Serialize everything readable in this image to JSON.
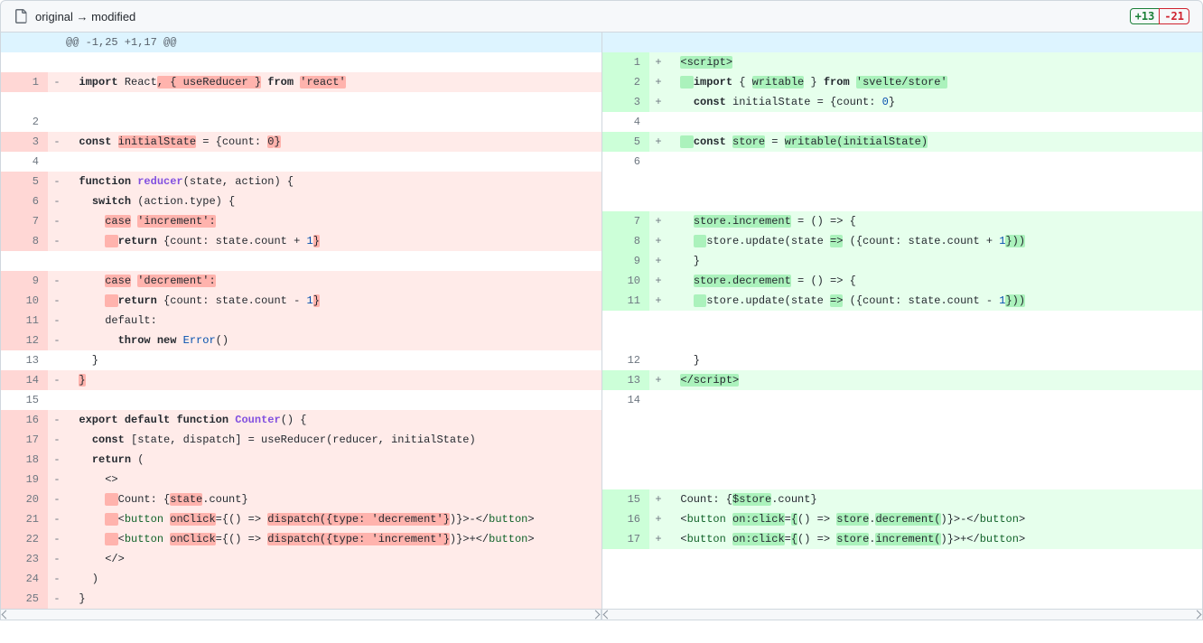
{
  "header": {
    "title": "original → modified",
    "additions": "+13",
    "deletions": "-21"
  },
  "hunk": "@@ -1,25 +1,17 @@",
  "left": [
    {
      "n": "",
      "t": "empty"
    },
    {
      "n": "1",
      "t": "del",
      "seg": [
        [
          "",
          "  "
        ],
        [
          "kw",
          "import"
        ],
        [
          "",
          " React"
        ],
        [
          "h-d",
          ", { useReducer }"
        ],
        [
          "",
          " "
        ],
        [
          "kw",
          "from"
        ],
        [
          "",
          " "
        ],
        [
          "h-d",
          "'react'"
        ]
      ]
    },
    {
      "n": "",
      "t": "empty"
    },
    {
      "n": "2",
      "t": "ctx",
      "seg": [
        [
          "",
          "  "
        ]
      ]
    },
    {
      "n": "3",
      "t": "del",
      "seg": [
        [
          "",
          "  "
        ],
        [
          "kw",
          "const"
        ],
        [
          "",
          " "
        ],
        [
          "h-d",
          "initialState"
        ],
        [
          "",
          " = {count: "
        ],
        [
          "h-d",
          "0"
        ],
        [
          "h-d",
          "}"
        ]
      ]
    },
    {
      "n": "4",
      "t": "ctx",
      "seg": [
        [
          "",
          "  "
        ]
      ]
    },
    {
      "n": "5",
      "t": "del",
      "seg": [
        [
          "",
          "  "
        ],
        [
          "kw",
          "function"
        ],
        [
          "",
          " "
        ],
        [
          "fn",
          "reducer"
        ],
        [
          "",
          "(state, action) {"
        ]
      ]
    },
    {
      "n": "6",
      "t": "del",
      "seg": [
        [
          "",
          "    "
        ],
        [
          "kw",
          "switch"
        ],
        [
          "",
          " (action.type) {"
        ]
      ]
    },
    {
      "n": "7",
      "t": "del",
      "seg": [
        [
          "",
          "      "
        ],
        [
          "h-d",
          "case"
        ],
        [
          "",
          " "
        ],
        [
          "h-d",
          "'increment':"
        ]
      ]
    },
    {
      "n": "8",
      "t": "del",
      "seg": [
        [
          "",
          "      "
        ],
        [
          "h-d",
          "  "
        ],
        [
          "kw",
          "return"
        ],
        [
          "",
          " {count: state.count + "
        ],
        [
          "nm",
          "1"
        ],
        [
          "h-d",
          "}"
        ]
      ]
    },
    {
      "n": "",
      "t": "empty"
    },
    {
      "n": "9",
      "t": "del",
      "seg": [
        [
          "",
          "      "
        ],
        [
          "h-d",
          "case"
        ],
        [
          "",
          " "
        ],
        [
          "h-d",
          "'decrement':"
        ]
      ]
    },
    {
      "n": "10",
      "t": "del",
      "seg": [
        [
          "",
          "      "
        ],
        [
          "h-d",
          "  "
        ],
        [
          "kw",
          "return"
        ],
        [
          "",
          " {count: state.count - "
        ],
        [
          "nm",
          "1"
        ],
        [
          "h-d",
          "}"
        ]
      ]
    },
    {
      "n": "11",
      "t": "del",
      "seg": [
        [
          "",
          "      default:"
        ]
      ]
    },
    {
      "n": "12",
      "t": "del",
      "seg": [
        [
          "",
          "        "
        ],
        [
          "kw",
          "throw"
        ],
        [
          "",
          " "
        ],
        [
          "kw",
          "new"
        ],
        [
          "",
          " "
        ],
        [
          "nm",
          "Error"
        ],
        [
          "",
          "()"
        ]
      ]
    },
    {
      "n": "13",
      "t": "ctx",
      "seg": [
        [
          "",
          "    }"
        ]
      ]
    },
    {
      "n": "14",
      "t": "del",
      "seg": [
        [
          "",
          "  "
        ],
        [
          "h-d",
          "}"
        ]
      ]
    },
    {
      "n": "15",
      "t": "ctx",
      "seg": [
        [
          "",
          "  "
        ]
      ]
    },
    {
      "n": "16",
      "t": "del",
      "seg": [
        [
          "",
          "  "
        ],
        [
          "kw",
          "export"
        ],
        [
          "",
          " "
        ],
        [
          "kw",
          "default"
        ],
        [
          "",
          " "
        ],
        [
          "kw",
          "function"
        ],
        [
          "",
          " "
        ],
        [
          "fn",
          "Counter"
        ],
        [
          "",
          "() {"
        ]
      ]
    },
    {
      "n": "17",
      "t": "del",
      "seg": [
        [
          "",
          "    "
        ],
        [
          "kw",
          "const"
        ],
        [
          "",
          " [state, dispatch] = useReducer(reducer, initialState)"
        ]
      ]
    },
    {
      "n": "18",
      "t": "del",
      "seg": [
        [
          "",
          "    "
        ],
        [
          "kw",
          "return"
        ],
        [
          "",
          " ("
        ]
      ]
    },
    {
      "n": "19",
      "t": "del",
      "seg": [
        [
          "",
          "      <>"
        ]
      ]
    },
    {
      "n": "20",
      "t": "del",
      "seg": [
        [
          "",
          "      "
        ],
        [
          "h-d",
          "  "
        ],
        [
          "",
          "Count: {"
        ],
        [
          "h-d",
          "state"
        ],
        [
          "",
          ".count}"
        ]
      ]
    },
    {
      "n": "21",
      "t": "del",
      "seg": [
        [
          "",
          "      "
        ],
        [
          "h-d",
          "  "
        ],
        [
          "",
          "<"
        ],
        [
          "tag",
          "button"
        ],
        [
          "",
          " "
        ],
        [
          "h-d",
          "onClick"
        ],
        [
          "",
          "={() => "
        ],
        [
          "h-d",
          "dispatch({type: 'decrement'}"
        ],
        [
          "",
          ")}>-</"
        ],
        [
          "tag",
          "button"
        ],
        [
          "",
          ">"
        ]
      ]
    },
    {
      "n": "22",
      "t": "del",
      "seg": [
        [
          "",
          "      "
        ],
        [
          "h-d",
          "  "
        ],
        [
          "",
          "<"
        ],
        [
          "tag",
          "button"
        ],
        [
          "",
          " "
        ],
        [
          "h-d",
          "onClick"
        ],
        [
          "",
          "={() => "
        ],
        [
          "h-d",
          "dispatch({type: 'increment'}"
        ],
        [
          "",
          ")}>+</"
        ],
        [
          "tag",
          "button"
        ],
        [
          "",
          ">"
        ]
      ]
    },
    {
      "n": "23",
      "t": "del",
      "seg": [
        [
          "",
          "      </>"
        ]
      ]
    },
    {
      "n": "24",
      "t": "del",
      "seg": [
        [
          "",
          "    )"
        ]
      ]
    },
    {
      "n": "25",
      "t": "del",
      "seg": [
        [
          "",
          "  }"
        ]
      ]
    }
  ],
  "right": [
    {
      "n": "1",
      "t": "add",
      "seg": [
        [
          "",
          "  "
        ],
        [
          "h-a",
          "<script>"
        ]
      ]
    },
    {
      "n": "2",
      "t": "add",
      "seg": [
        [
          "",
          "  "
        ],
        [
          "h-a",
          "  "
        ],
        [
          "kw",
          "import"
        ],
        [
          "",
          " { "
        ],
        [
          "h-a",
          "writable"
        ],
        [
          "",
          " } "
        ],
        [
          "kw",
          "from"
        ],
        [
          "",
          " "
        ],
        [
          "h-a",
          "'svelte/store'"
        ]
      ]
    },
    {
      "n": "3",
      "t": "add",
      "seg": [
        [
          "",
          "    "
        ],
        [
          "kw",
          "const"
        ],
        [
          "",
          " initialState = {count: "
        ],
        [
          "nm",
          "0"
        ],
        [
          "",
          "}"
        ]
      ]
    },
    {
      "n": "4",
      "t": "ctx",
      "seg": [
        [
          "",
          "  "
        ]
      ]
    },
    {
      "n": "5",
      "t": "add",
      "seg": [
        [
          "",
          "  "
        ],
        [
          "h-a",
          "  "
        ],
        [
          "kw",
          "const"
        ],
        [
          "",
          " "
        ],
        [
          "h-a",
          "store"
        ],
        [
          "",
          " = "
        ],
        [
          "h-a",
          "writable(initialState)"
        ]
      ]
    },
    {
      "n": "6",
      "t": "ctx",
      "seg": [
        [
          "",
          "  "
        ]
      ]
    },
    {
      "n": "",
      "t": "empty"
    },
    {
      "n": "",
      "t": "empty"
    },
    {
      "n": "7",
      "t": "add",
      "seg": [
        [
          "",
          "    "
        ],
        [
          "h-a",
          "store.increment"
        ],
        [
          "",
          " = () => {"
        ]
      ]
    },
    {
      "n": "8",
      "t": "add",
      "seg": [
        [
          "",
          "    "
        ],
        [
          "h-a",
          "  "
        ],
        [
          "",
          "store.update(state "
        ],
        [
          "h-a",
          "=>"
        ],
        [
          "",
          " ({count: state.count + "
        ],
        [
          "nm",
          "1"
        ],
        [
          "h-a",
          "}))"
        ]
      ]
    },
    {
      "n": "9",
      "t": "add",
      "seg": [
        [
          "",
          "    }"
        ]
      ]
    },
    {
      "n": "10",
      "t": "add",
      "seg": [
        [
          "",
          "    "
        ],
        [
          "h-a",
          "store.decrement"
        ],
        [
          "",
          " = () => {"
        ]
      ]
    },
    {
      "n": "11",
      "t": "add",
      "seg": [
        [
          "",
          "    "
        ],
        [
          "h-a",
          "  "
        ],
        [
          "",
          "store.update(state "
        ],
        [
          "h-a",
          "=>"
        ],
        [
          "",
          " ({count: state.count - "
        ],
        [
          "nm",
          "1"
        ],
        [
          "h-a",
          "}))"
        ]
      ]
    },
    {
      "n": "",
      "t": "empty"
    },
    {
      "n": "",
      "t": "empty"
    },
    {
      "n": "12",
      "t": "ctx",
      "seg": [
        [
          "",
          "    }"
        ]
      ]
    },
    {
      "n": "13",
      "t": "add",
      "seg": [
        [
          "",
          "  "
        ],
        [
          "h-a",
          "</script>"
        ]
      ]
    },
    {
      "n": "14",
      "t": "ctx",
      "seg": [
        [
          "",
          "  "
        ]
      ]
    },
    {
      "n": "",
      "t": "empty"
    },
    {
      "n": "",
      "t": "empty"
    },
    {
      "n": "",
      "t": "empty"
    },
    {
      "n": "",
      "t": "empty"
    },
    {
      "n": "15",
      "t": "add",
      "seg": [
        [
          "",
          "  Count: {"
        ],
        [
          "h-a",
          "$store"
        ],
        [
          "",
          ".count}"
        ]
      ]
    },
    {
      "n": "16",
      "t": "add",
      "seg": [
        [
          "",
          "  <"
        ],
        [
          "tag",
          "button"
        ],
        [
          "",
          " "
        ],
        [
          "h-a",
          "on:click"
        ],
        [
          "",
          "="
        ],
        [
          "h-a",
          "{"
        ],
        [
          "",
          "() => "
        ],
        [
          "h-a",
          "store"
        ],
        [
          "",
          "."
        ],
        [
          "h-a",
          "decrement("
        ],
        [
          "",
          ")}>-</"
        ],
        [
          "tag",
          "button"
        ],
        [
          "",
          ">"
        ]
      ]
    },
    {
      "n": "17",
      "t": "add",
      "seg": [
        [
          "",
          "  <"
        ],
        [
          "tag",
          "button"
        ],
        [
          "",
          " "
        ],
        [
          "h-a",
          "on:click"
        ],
        [
          "",
          "="
        ],
        [
          "h-a",
          "{"
        ],
        [
          "",
          "() => "
        ],
        [
          "h-a",
          "store"
        ],
        [
          "",
          "."
        ],
        [
          "h-a",
          "increment("
        ],
        [
          "",
          ")}>+</"
        ],
        [
          "tag",
          "button"
        ],
        [
          "",
          ">"
        ]
      ]
    },
    {
      "n": "",
      "t": "empty"
    },
    {
      "n": "",
      "t": "empty"
    },
    {
      "n": "",
      "t": "empty"
    }
  ]
}
